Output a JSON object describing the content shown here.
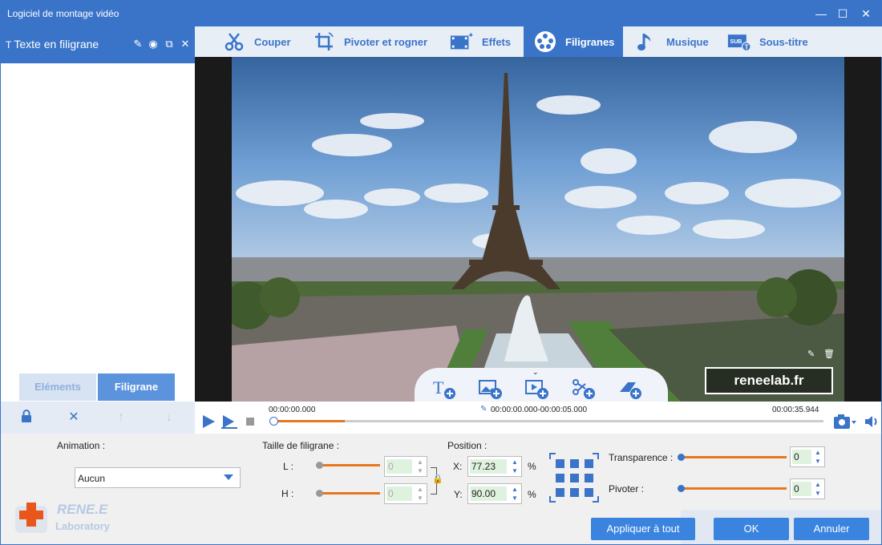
{
  "window": {
    "title": "Logiciel de montage vidéo",
    "minimize": "—",
    "maximize": "☐",
    "close": "✕"
  },
  "sidebar": {
    "header_label": "Texte en filigrane",
    "tabs": [
      "Eléments",
      "Filigrane"
    ],
    "active_tab": "Filigrane"
  },
  "tabs": [
    {
      "label": "Couper",
      "icon": "scissors-icon"
    },
    {
      "label": "Pivoter et rogner",
      "icon": "crop-rotate-icon"
    },
    {
      "label": "Effets",
      "icon": "effects-film-icon"
    },
    {
      "label": "Filigranes",
      "icon": "film-reel-icon",
      "active": true
    },
    {
      "label": "Musique",
      "icon": "music-note-icon"
    },
    {
      "label": "Sous-titre",
      "icon": "subtitle-icon"
    }
  ],
  "preview": {
    "watermark_text": "reneelab.fr"
  },
  "timeline": {
    "start_time": "00:00:00.000",
    "range": "00:00:00.000-00:00:05.000",
    "end_time": "00:00:35.944",
    "progress": 0.13
  },
  "settings": {
    "animation_label": "Animation :",
    "animation_value": "Aucun",
    "size_label": "Taille de filigrane :",
    "width_label": "L :",
    "width_value": "0",
    "height_label": "H :",
    "height_value": "0",
    "position_label": "Position :",
    "x_label": "X:",
    "x_value": "77.23",
    "y_label": "Y:",
    "y_value": "90.00",
    "percent": "%",
    "transparency_label": "Transparence :",
    "transparency_value": "0",
    "rotate_label": "Pivoter :",
    "rotate_value": "0"
  },
  "buttons": {
    "apply_all": "Appliquer à tout",
    "ok": "OK",
    "cancel": "Annuler"
  },
  "logo": {
    "line1": "RENE.E",
    "line2": "Laboratory"
  },
  "colors": {
    "accent": "#3a74c9",
    "slider": "#e8761c",
    "button": "#3a84e0"
  }
}
